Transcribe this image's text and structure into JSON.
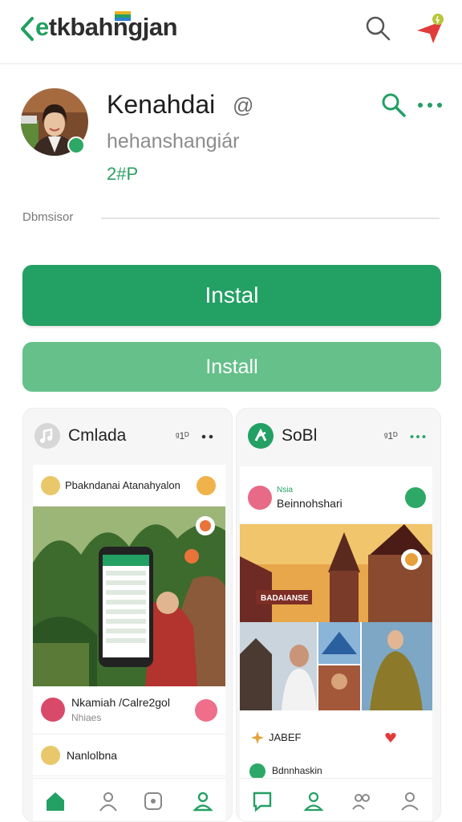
{
  "topbar": {
    "brand_first": "e",
    "brand_rest": "tkbahngjan"
  },
  "profile": {
    "name": "Kenahdai",
    "name_suffix": "@",
    "handle": "hehanshangiár",
    "count": "2#P"
  },
  "section": {
    "label": "Dbmsisor"
  },
  "buttons": {
    "primary": "Instal",
    "secondary": "Install"
  },
  "cards": {
    "left": {
      "title": "Cmlada",
      "meta": "ᵍ1ᴰ",
      "row1": "Pbakndanai Atanahyalon",
      "row2_title": "Nkamiah /Calre2gol",
      "row2_sub": "Nhiaes",
      "row3": "Nanlolbna"
    },
    "right": {
      "title": "SoBl",
      "meta": "ᵍ1ᴰ",
      "post_tag": "Nsia",
      "post_name": "Beinnohshari",
      "banner_text": "BADAIANSE",
      "footer_text": "JABEF",
      "bottom_text": "Bdnnhaskin"
    }
  },
  "colors": {
    "accent": "#23a064",
    "accent_light": "#65c08a"
  }
}
